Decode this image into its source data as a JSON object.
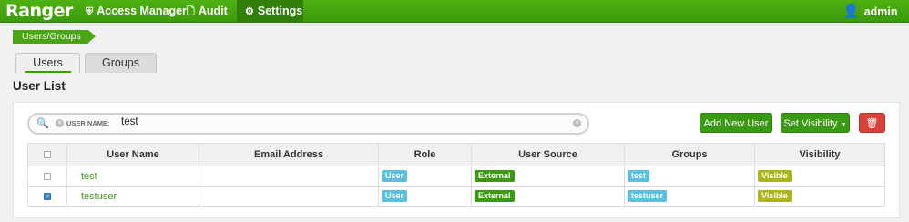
{
  "nav": {
    "brand": "Ranger",
    "items": [
      {
        "label": "Access Manager",
        "icon": "shield-icon"
      },
      {
        "label": "Audit",
        "icon": "file-icon"
      },
      {
        "label": "Settings",
        "icon": "gear-icon"
      }
    ],
    "user": "admin"
  },
  "breadcrumb": "Users/Groups",
  "tabs": [
    "Users",
    "Groups"
  ],
  "section_title": "User List",
  "search": {
    "filter_name": "USER NAME:",
    "filter_value": "test"
  },
  "buttons": {
    "add_user": "Add New User",
    "set_visibility": "Set Visibility"
  },
  "table": {
    "columns": [
      "User Name",
      "Email Address",
      "Role",
      "User Source",
      "Groups",
      "Visibility"
    ],
    "rows": [
      {
        "checked": false,
        "name": "test",
        "email": "",
        "role": "User",
        "source": "External",
        "groups": "test",
        "visibility": "Visible"
      },
      {
        "checked": true,
        "name": "testuser",
        "email": "",
        "role": "User",
        "source": "External",
        "groups": "testuser",
        "visibility": "Visible"
      }
    ]
  },
  "colors": {
    "brand_green": "#3a9a13",
    "label_blue": "#5bc0de",
    "visible_olive": "#a9b618",
    "delete_red": "#d9423b"
  }
}
